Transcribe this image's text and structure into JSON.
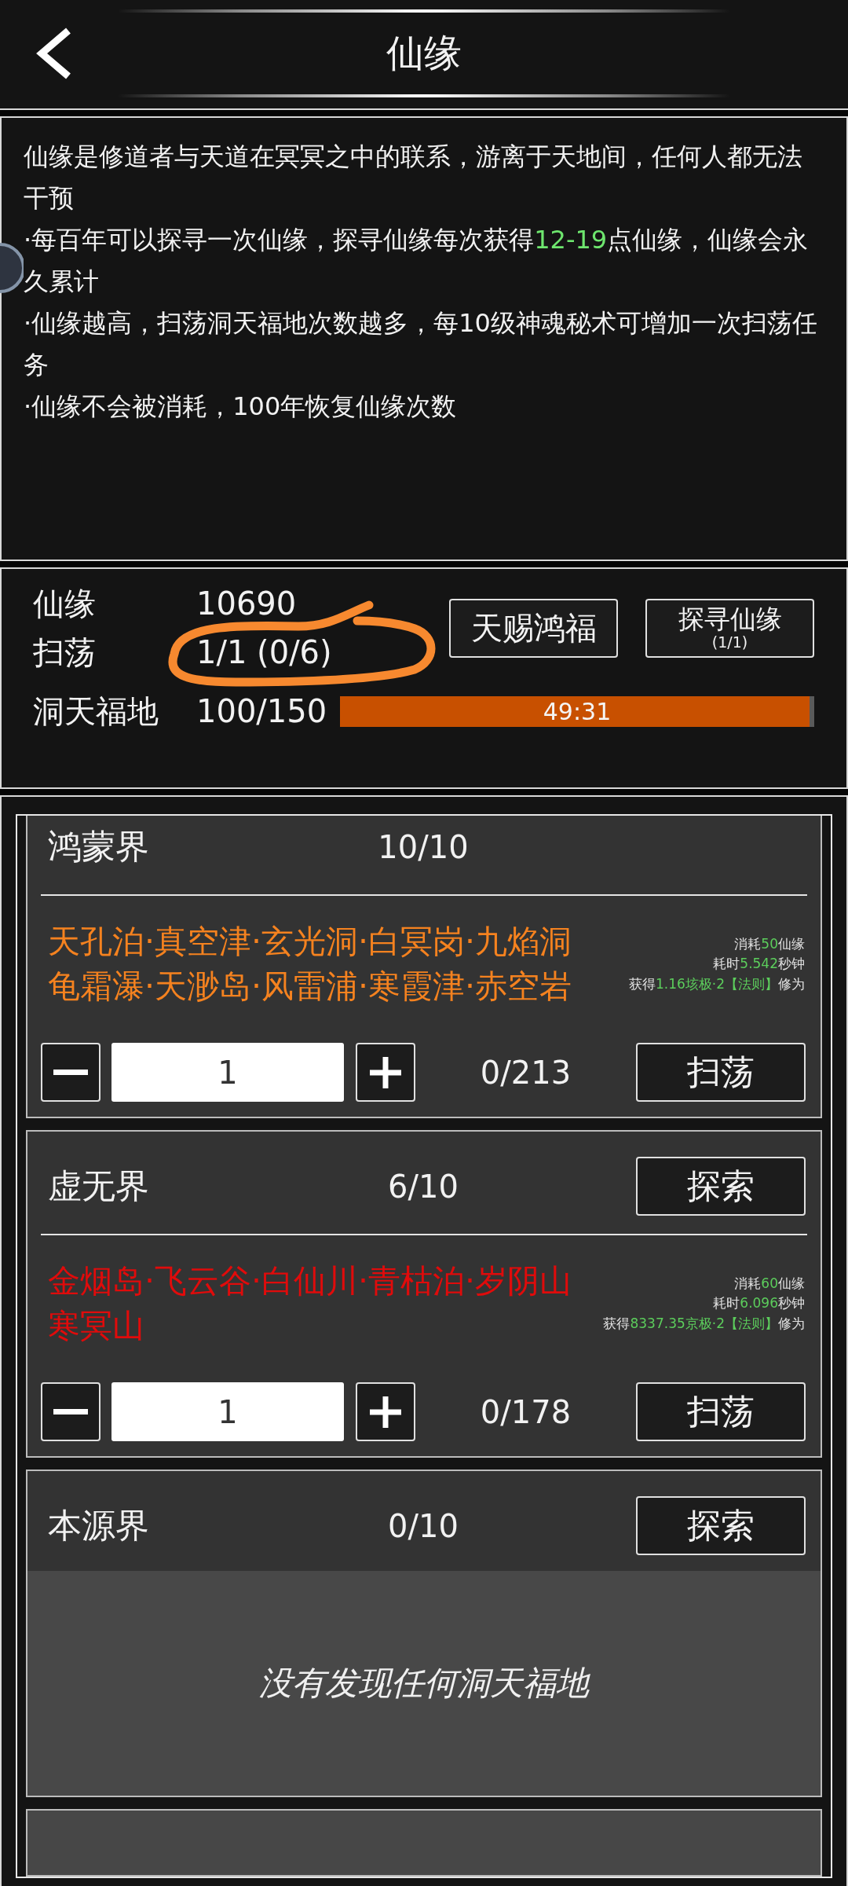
{
  "header": {
    "title": "仙缘"
  },
  "description": {
    "paragraphs": [
      [
        {
          "text": "仙缘是修道者与天道在冥冥之中的联系，游离于天地间，任何人都无法干预",
          "highlight": false
        }
      ],
      [
        {
          "text": "·每百年可以探寻一次仙缘，探寻仙缘每次获得",
          "highlight": false
        },
        {
          "text": "12-19",
          "highlight": true
        },
        {
          "text": "点仙缘，仙缘会永久累计",
          "highlight": false
        }
      ],
      [
        {
          "text": "·仙缘越高，扫荡洞天福地次数越多，每10级神魂秘术可增加一次扫荡任务",
          "highlight": false
        }
      ],
      [
        {
          "text": "·仙缘不会被消耗，100年恢复仙缘次数",
          "highlight": false
        }
      ]
    ]
  },
  "stats": {
    "rows": [
      {
        "label": "仙缘",
        "value": "10690"
      },
      {
        "label": "扫荡",
        "value": "1/1 (0/6)"
      }
    ],
    "buttons": [
      {
        "label": "天赐鸿福"
      },
      {
        "label": "探寻仙缘",
        "sublabel": "(1/1)"
      }
    ],
    "blessed_land": {
      "label": "洞天福地",
      "value": "100/150",
      "timer": "49:31",
      "level": 0.99
    }
  },
  "realms": [
    {
      "kind": "detail",
      "name": "鸿蒙界",
      "count": "10/10",
      "color": "#f5821f",
      "places": [
        "天孔泊·真空津·玄光洞·白冥岗·九焰洞",
        "龟霜瀑·天渺岛·风雷浦·寒霞津·赤空岩"
      ],
      "info": [
        [
          {
            "text": "消耗",
            "highlight": false
          },
          {
            "text": "50",
            "highlight": true
          },
          {
            "text": "仙缘",
            "highlight": false
          }
        ],
        [
          {
            "text": "耗时",
            "highlight": false
          },
          {
            "text": "5.542",
            "highlight": true
          },
          {
            "text": "秒钟",
            "highlight": false
          }
        ],
        [
          {
            "text": "获得",
            "highlight": false
          },
          {
            "text": "1.16垓极·2【法则】",
            "highlight": true
          },
          {
            "text": "修为",
            "highlight": false
          }
        ]
      ],
      "quantity": "1",
      "progress": "0/213",
      "sweep_button": "扫荡"
    },
    {
      "kind": "detail",
      "name": "虚无界",
      "count": "6/10",
      "explore_button": "探索",
      "color": "#e00b0b",
      "places": [
        "金烟岛·飞云谷·白仙川·青枯泊·岁阴山",
        "寒冥山"
      ],
      "info": [
        [
          {
            "text": "消耗",
            "highlight": false
          },
          {
            "text": "60",
            "highlight": true
          },
          {
            "text": "仙缘",
            "highlight": false
          }
        ],
        [
          {
            "text": "耗时",
            "highlight": false
          },
          {
            "text": "6.096",
            "highlight": true
          },
          {
            "text": "秒钟",
            "highlight": false
          }
        ],
        [
          {
            "text": "获得",
            "highlight": false
          },
          {
            "text": "8337.35京极·2【法则】",
            "highlight": true
          },
          {
            "text": "修为",
            "highlight": false
          }
        ]
      ],
      "quantity": "1",
      "progress": "0/178",
      "sweep_button": "扫荡"
    },
    {
      "kind": "empty",
      "name": "本源界",
      "count": "0/10",
      "explore_button": "探索",
      "empty_text": "没有发现任何洞天福地"
    },
    {
      "kind": "blank"
    }
  ]
}
